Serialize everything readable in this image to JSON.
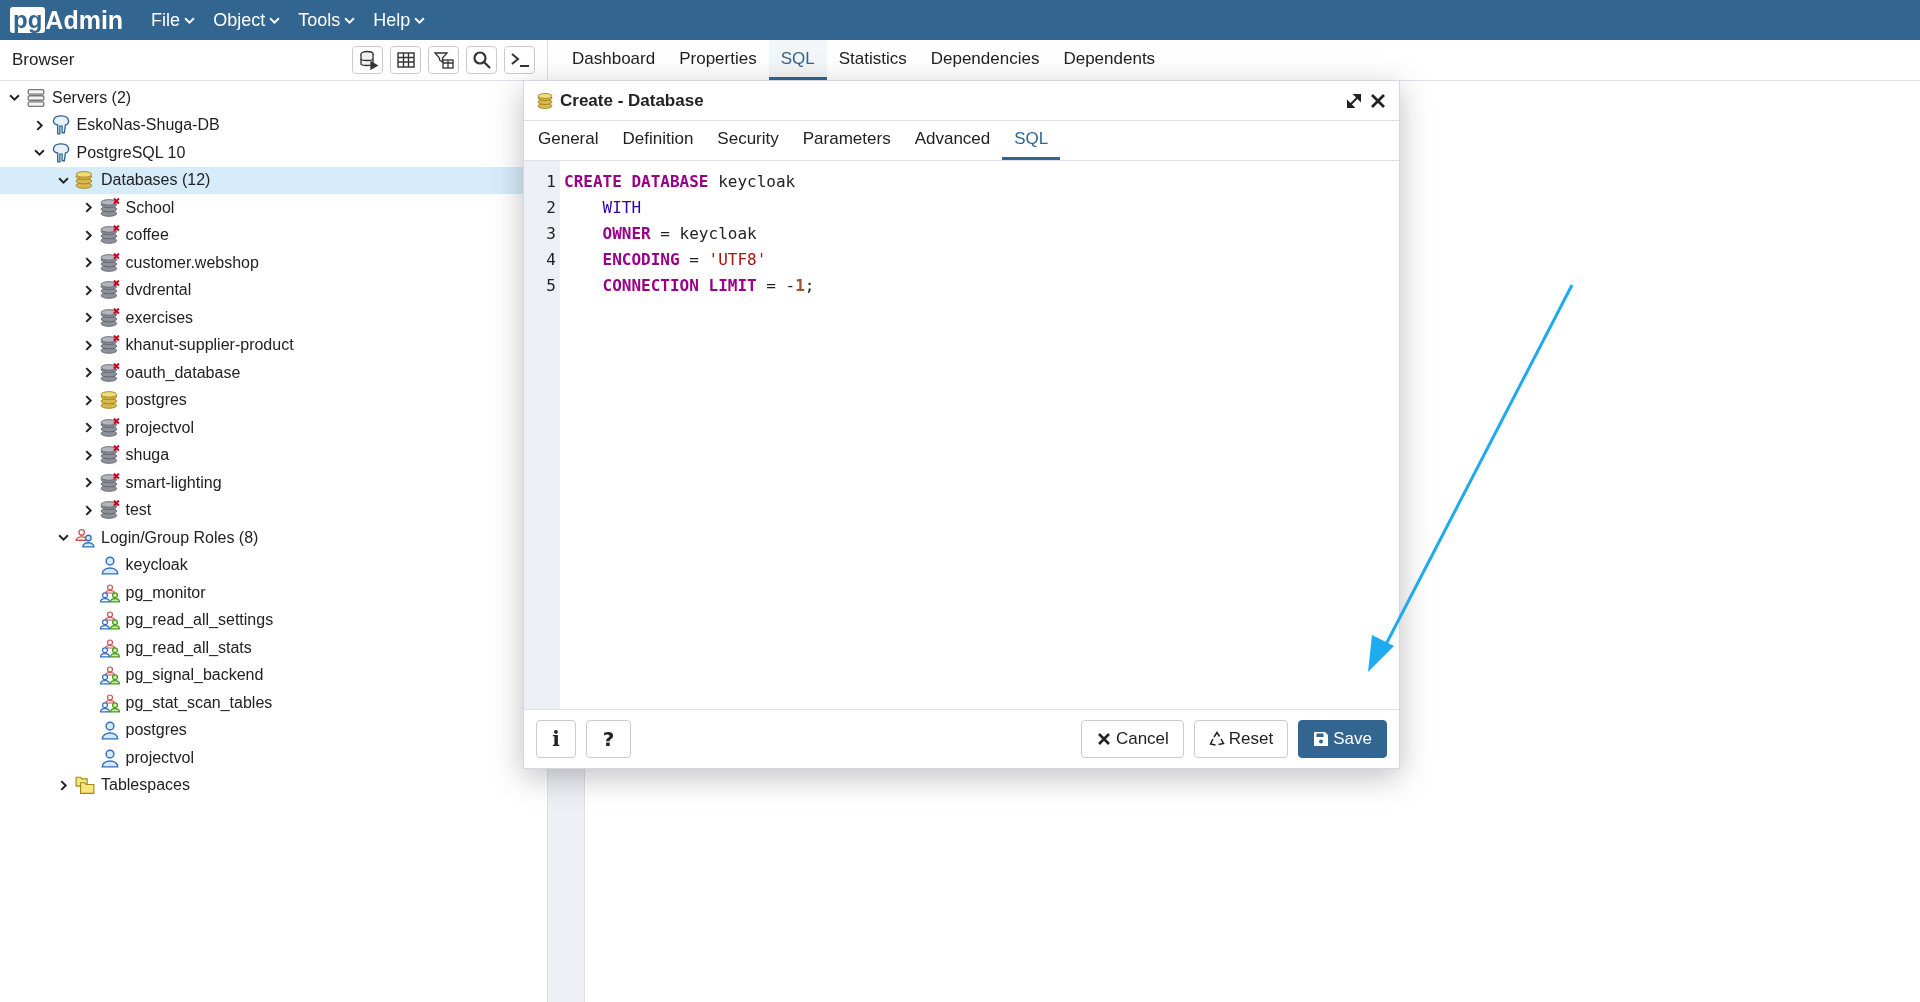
{
  "topbar": {
    "logo": {
      "badge": "pg",
      "text": "Admin"
    },
    "menus": [
      "File",
      "Object",
      "Tools",
      "Help"
    ]
  },
  "browser": {
    "title": "Browser",
    "tree": [
      {
        "label": "Servers (2)",
        "kind": "servers",
        "expanded": true,
        "selected": false,
        "children": [
          {
            "label": "EskoNas-Shuga-DB",
            "kind": "server",
            "expanded": false,
            "selected": false
          },
          {
            "label": "PostgreSQL 10",
            "kind": "server",
            "expanded": true,
            "selected": false,
            "children": [
              {
                "label": "Databases (12)",
                "kind": "databases",
                "expanded": true,
                "selected": true,
                "children": [
                  {
                    "label": "School",
                    "kind": "database",
                    "connected": false,
                    "expanded": false,
                    "selected": false
                  },
                  {
                    "label": "coffee",
                    "kind": "database",
                    "connected": false,
                    "expanded": false,
                    "selected": false
                  },
                  {
                    "label": "customer.webshop",
                    "kind": "database",
                    "connected": false,
                    "expanded": false,
                    "selected": false
                  },
                  {
                    "label": "dvdrental",
                    "kind": "database",
                    "connected": false,
                    "expanded": false,
                    "selected": false
                  },
                  {
                    "label": "exercises",
                    "kind": "database",
                    "connected": false,
                    "expanded": false,
                    "selected": false
                  },
                  {
                    "label": "khanut-supplier-product",
                    "kind": "database",
                    "connected": false,
                    "expanded": false,
                    "selected": false
                  },
                  {
                    "label": "oauth_database",
                    "kind": "database",
                    "connected": false,
                    "expanded": false,
                    "selected": false
                  },
                  {
                    "label": "postgres",
                    "kind": "database",
                    "connected": true,
                    "expanded": false,
                    "selected": false
                  },
                  {
                    "label": "projectvol",
                    "kind": "database",
                    "connected": false,
                    "expanded": false,
                    "selected": false
                  },
                  {
                    "label": "shuga",
                    "kind": "database",
                    "connected": false,
                    "expanded": false,
                    "selected": false
                  },
                  {
                    "label": "smart-lighting",
                    "kind": "database",
                    "connected": false,
                    "expanded": false,
                    "selected": false
                  },
                  {
                    "label": "test",
                    "kind": "database",
                    "connected": false,
                    "expanded": false,
                    "selected": false
                  }
                ]
              },
              {
                "label": "Login/Group Roles (8)",
                "kind": "roles",
                "expanded": true,
                "selected": false,
                "children": [
                  {
                    "label": "keycloak",
                    "kind": "login-role",
                    "selected": false
                  },
                  {
                    "label": "pg_monitor",
                    "kind": "group-role",
                    "selected": false
                  },
                  {
                    "label": "pg_read_all_settings",
                    "kind": "group-role",
                    "selected": false
                  },
                  {
                    "label": "pg_read_all_stats",
                    "kind": "group-role",
                    "selected": false
                  },
                  {
                    "label": "pg_signal_backend",
                    "kind": "group-role",
                    "selected": false
                  },
                  {
                    "label": "pg_stat_scan_tables",
                    "kind": "group-role",
                    "selected": false
                  },
                  {
                    "label": "postgres",
                    "kind": "login-role",
                    "selected": false
                  },
                  {
                    "label": "projectvol",
                    "kind": "login-role",
                    "selected": false
                  }
                ]
              },
              {
                "label": "Tablespaces",
                "kind": "tablespaces",
                "expanded": false,
                "selected": false
              }
            ]
          }
        ]
      }
    ]
  },
  "main_tabs": [
    {
      "label": "Dashboard",
      "selected": false
    },
    {
      "label": "Properties",
      "selected": false
    },
    {
      "label": "SQL",
      "selected": true
    },
    {
      "label": "Statistics",
      "selected": false
    },
    {
      "label": "Dependencies",
      "selected": false
    },
    {
      "label": "Dependents",
      "selected": false
    }
  ],
  "dialog": {
    "title": "Create - Database",
    "tabs": [
      {
        "label": "General",
        "selected": false
      },
      {
        "label": "Definition",
        "selected": false
      },
      {
        "label": "Security",
        "selected": false
      },
      {
        "label": "Parameters",
        "selected": false
      },
      {
        "label": "Advanced",
        "selected": false
      },
      {
        "label": "SQL",
        "selected": true
      }
    ],
    "code": [
      {
        "number": "1",
        "indented": false,
        "tokens": [
          {
            "text": "CREATE DATABASE",
            "kind": "keyword"
          },
          {
            "text": " keycloak",
            "kind": "plain"
          }
        ]
      },
      {
        "number": "2",
        "indented": true,
        "tokens": [
          {
            "text": "WITH",
            "kind": "builtin"
          }
        ]
      },
      {
        "number": "3",
        "indented": true,
        "tokens": [
          {
            "text": "OWNER",
            "kind": "keyword"
          },
          {
            "text": " = keycloak",
            "kind": "plain"
          }
        ]
      },
      {
        "number": "4",
        "indented": true,
        "tokens": [
          {
            "text": "ENCODING",
            "kind": "keyword"
          },
          {
            "text": " = ",
            "kind": "plain"
          },
          {
            "text": "'UTF8'",
            "kind": "string"
          }
        ]
      },
      {
        "number": "5",
        "indented": true,
        "tokens": [
          {
            "text": "CONNECTION LIMIT",
            "kind": "keyword"
          },
          {
            "text": " = -",
            "kind": "plain"
          },
          {
            "text": "1",
            "kind": "number"
          },
          {
            "text": ";",
            "kind": "plain"
          }
        ]
      }
    ],
    "help_buttons": [
      "i",
      "?"
    ],
    "buttons": [
      {
        "label": "Cancel",
        "kind": "cancel"
      },
      {
        "label": "Reset",
        "kind": "reset"
      },
      {
        "label": "Save",
        "kind": "save"
      }
    ]
  }
}
